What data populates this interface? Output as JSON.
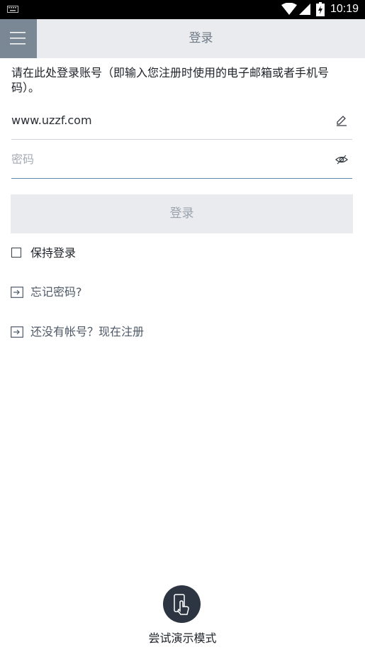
{
  "status_bar": {
    "time": "10:19",
    "icons": [
      "keyboard-icon",
      "wifi-icon",
      "signal-icon",
      "battery-icon"
    ]
  },
  "app_bar": {
    "title": "登录",
    "menu_icon": "hamburger-menu-icon"
  },
  "instruction": "请在此处登录账号（即输入您注册时使用的电子邮箱或者手机号码）。",
  "username_field": {
    "value": "www.uzzf.com",
    "trailing_icon": "edit-pencil-icon"
  },
  "password_field": {
    "placeholder": "密码",
    "trailing_icon": "eye-icon"
  },
  "login_button": {
    "label": "登录"
  },
  "keep_login": {
    "label": "保持登录",
    "checked": false
  },
  "links": {
    "forgot_password": "忘记密码?",
    "register": "还没有帐号？现在注册"
  },
  "demo": {
    "label": "尝试演示模式",
    "icon": "phone-tap-icon"
  },
  "colors": {
    "app_bar_bg": "#e9ebee",
    "menu_button_bg": "#7a8795",
    "active_underline": "#5e8ab0",
    "demo_button_bg": "#2c3541"
  }
}
